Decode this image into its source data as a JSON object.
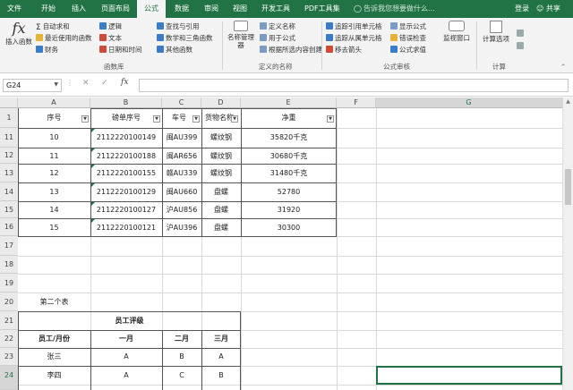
{
  "tabs": [
    "文件",
    "开始",
    "插入",
    "页面布局",
    "公式",
    "数据",
    "审阅",
    "视图",
    "开发工具",
    "PDF工具集"
  ],
  "tell_me": "告诉我您想要做什么...",
  "login": "登录",
  "share": "共享",
  "ribbon": {
    "insert_function": "插入函数",
    "autosum": "自动求和",
    "recent": "最近使用的函数",
    "financial": "财务",
    "logical": "逻辑",
    "text": "文本",
    "datetime": "日期和时间",
    "lookup": "查找与引用",
    "math": "数学和三角函数",
    "more": "其他函数",
    "group_library": "函数库",
    "name_manager": "名称管理器",
    "define_name": "定义名称",
    "use_in_formula": "用于公式",
    "create_from_sel": "根据所选内容创建",
    "group_names": "定义的名称",
    "trace_precedents": "追踪引用单元格",
    "trace_dependents": "追踪从属单元格",
    "remove_arrows": "移去箭头",
    "show_formulas": "显示公式",
    "error_check": "错误检查",
    "evaluate": "公式求值",
    "group_audit": "公式审核",
    "watch": "监视窗口",
    "calc_options": "计算选项",
    "group_calc": "计算"
  },
  "namebox": "G24",
  "fx": "fx",
  "columns": [
    "A",
    "B",
    "C",
    "D",
    "E",
    "F",
    "G"
  ],
  "row_numbers": [
    "1",
    "11",
    "12",
    "13",
    "14",
    "15",
    "16",
    "17",
    "18",
    "19",
    "20",
    "21",
    "22",
    "23",
    "24"
  ],
  "table1": {
    "headers": [
      "序号",
      "磅单序号",
      "车号",
      "货物名称",
      "净重"
    ],
    "rows": [
      [
        "10",
        "2112220100149",
        "闽AU399",
        "螺纹钢",
        "35820千克"
      ],
      [
        "11",
        "2112220100188",
        "闽AR656",
        "螺纹钢",
        "30680千克"
      ],
      [
        "12",
        "2112220100155",
        "赣AU339",
        "螺纹钢",
        "31480千克"
      ],
      [
        "13",
        "2112220100129",
        "闽AU660",
        "盘螺",
        "52780"
      ],
      [
        "14",
        "2112220100127",
        "沪AU856",
        "盘螺",
        "31920"
      ],
      [
        "15",
        "2112220100121",
        "沪AU396",
        "盘螺",
        "30300"
      ]
    ]
  },
  "second_table_label": "第二个表",
  "table2": {
    "title": "员工评级",
    "headers": [
      "员工/月份",
      "一月",
      "二月",
      "三月"
    ],
    "rows": [
      [
        "张三",
        "A",
        "B",
        "A"
      ],
      [
        "李四",
        "A",
        "C",
        "B"
      ]
    ]
  }
}
